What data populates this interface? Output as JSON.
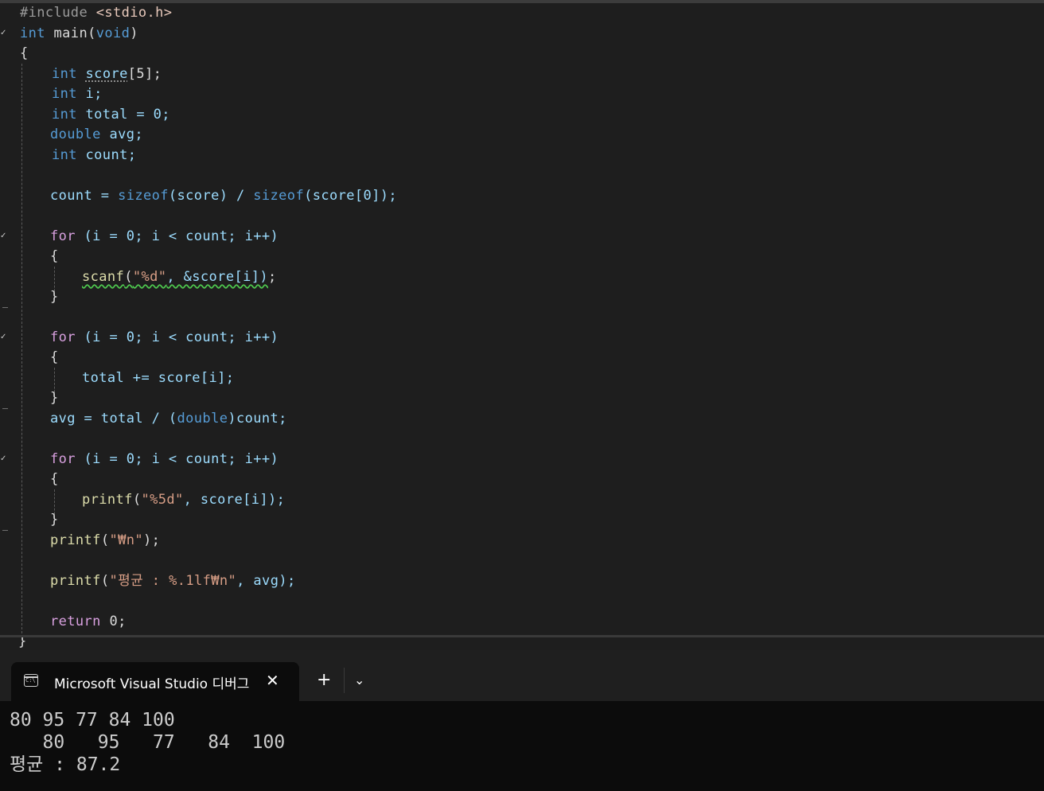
{
  "editor": {
    "lines": [
      [
        "#include ",
        "<stdio.h>"
      ],
      [
        "int",
        " main(",
        "void",
        ")"
      ],
      [
        "{"
      ],
      [
        "int",
        " ",
        "score",
        "[5];"
      ],
      [
        "int",
        " i;"
      ],
      [
        "int",
        " total = 0;"
      ],
      [
        "double",
        " avg;"
      ],
      [
        "int",
        " count;"
      ],
      [
        ""
      ],
      [
        "count = ",
        "sizeof",
        "(score) / ",
        "sizeof",
        "(score[0]);"
      ],
      [
        ""
      ],
      [
        "for",
        " (i = 0; i < count; i++)"
      ],
      [
        "{"
      ],
      [
        "scanf",
        "(",
        "\"%d\"",
        ", &score[i])",
        ";"
      ],
      [
        "}"
      ],
      [
        ""
      ],
      [
        "for",
        " (i = 0; i < count; i++)"
      ],
      [
        "{"
      ],
      [
        "total += score[i];"
      ],
      [
        "}"
      ],
      [
        "avg = total / (",
        "double",
        ")count;"
      ],
      [
        ""
      ],
      [
        "for",
        " (i = 0; i < count; i++)"
      ],
      [
        "{"
      ],
      [
        "printf",
        "(",
        "\"%5d\"",
        ", score[i]);"
      ],
      [
        "}"
      ],
      [
        "printf",
        "(",
        "\"₩n\"",
        ");"
      ],
      [
        ""
      ],
      [
        "printf",
        "(",
        "\"평균 : %.1lf₩n\"",
        ", avg);"
      ],
      [
        ""
      ],
      [
        "return",
        " 0;"
      ],
      [
        "}"
      ]
    ]
  },
  "terminal": {
    "tab_title": "Microsoft Visual Studio 디버그",
    "close_glyph": "✕",
    "new_tab_glyph": "+",
    "dropdown_glyph": "⌄",
    "icon_text": "C:\\",
    "output": [
      "80 95 77 84 100",
      "   80   95   77   84  100",
      "평균 : 87.2"
    ]
  }
}
